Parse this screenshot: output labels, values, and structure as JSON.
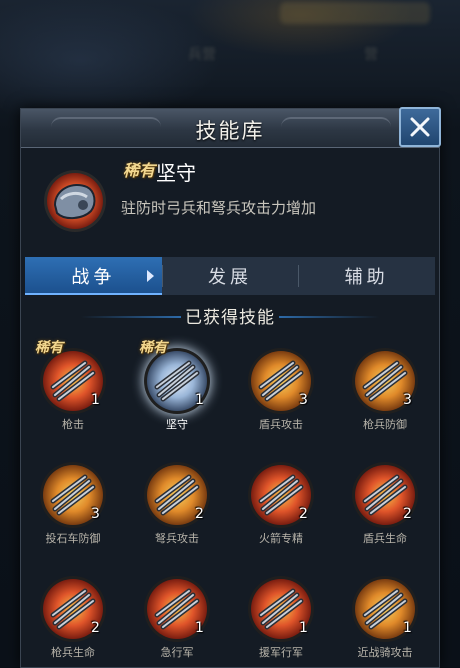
{
  "panel": {
    "title": "技能库"
  },
  "selected_skill": {
    "rarity": "稀有",
    "name": "坚守",
    "description": "驻防时弓兵和弩兵攻击力增加"
  },
  "tabs": [
    {
      "label": "战争",
      "active": true
    },
    {
      "label": "发展",
      "active": false
    },
    {
      "label": "辅助",
      "active": false
    }
  ],
  "section_title": "已获得技能",
  "skills": [
    {
      "name": "枪击",
      "level": "1",
      "rarity": "稀有",
      "icon": "triple-spear-icon"
    },
    {
      "name": "坚守",
      "level": "1",
      "rarity": "稀有",
      "icon": "armored-fist-icon"
    },
    {
      "name": "盾兵攻击",
      "level": "3",
      "icon": "shield-soldier-attack-icon"
    },
    {
      "name": "枪兵防御",
      "level": "3",
      "icon": "spear-soldier-shield-icon"
    },
    {
      "name": "投石车防御",
      "level": "3",
      "icon": "catapult-shield-icon"
    },
    {
      "name": "弩兵攻击",
      "level": "2",
      "icon": "crossbowman-attack-icon"
    },
    {
      "name": "火箭专精",
      "level": "2",
      "icon": "fire-arrows-icon"
    },
    {
      "name": "盾兵生命",
      "level": "2",
      "icon": "shield-soldier-heart-icon"
    },
    {
      "name": "枪兵生命",
      "level": "2",
      "icon": "spear-soldier-heart-icon"
    },
    {
      "name": "急行军",
      "level": "1",
      "icon": "armored-boot-icon"
    },
    {
      "name": "援军行军",
      "level": "1",
      "icon": "war-banner-icon"
    },
    {
      "name": "近战骑攻击",
      "level": "1",
      "icon": "cavalry-attack-icon"
    }
  ],
  "colors": {
    "tab_active": "#2e6fb4",
    "panel_bg": "#141b24",
    "rarity_gold": "#f3d890"
  },
  "background": {
    "blurred_labels": [
      "兵营",
      "营"
    ]
  }
}
